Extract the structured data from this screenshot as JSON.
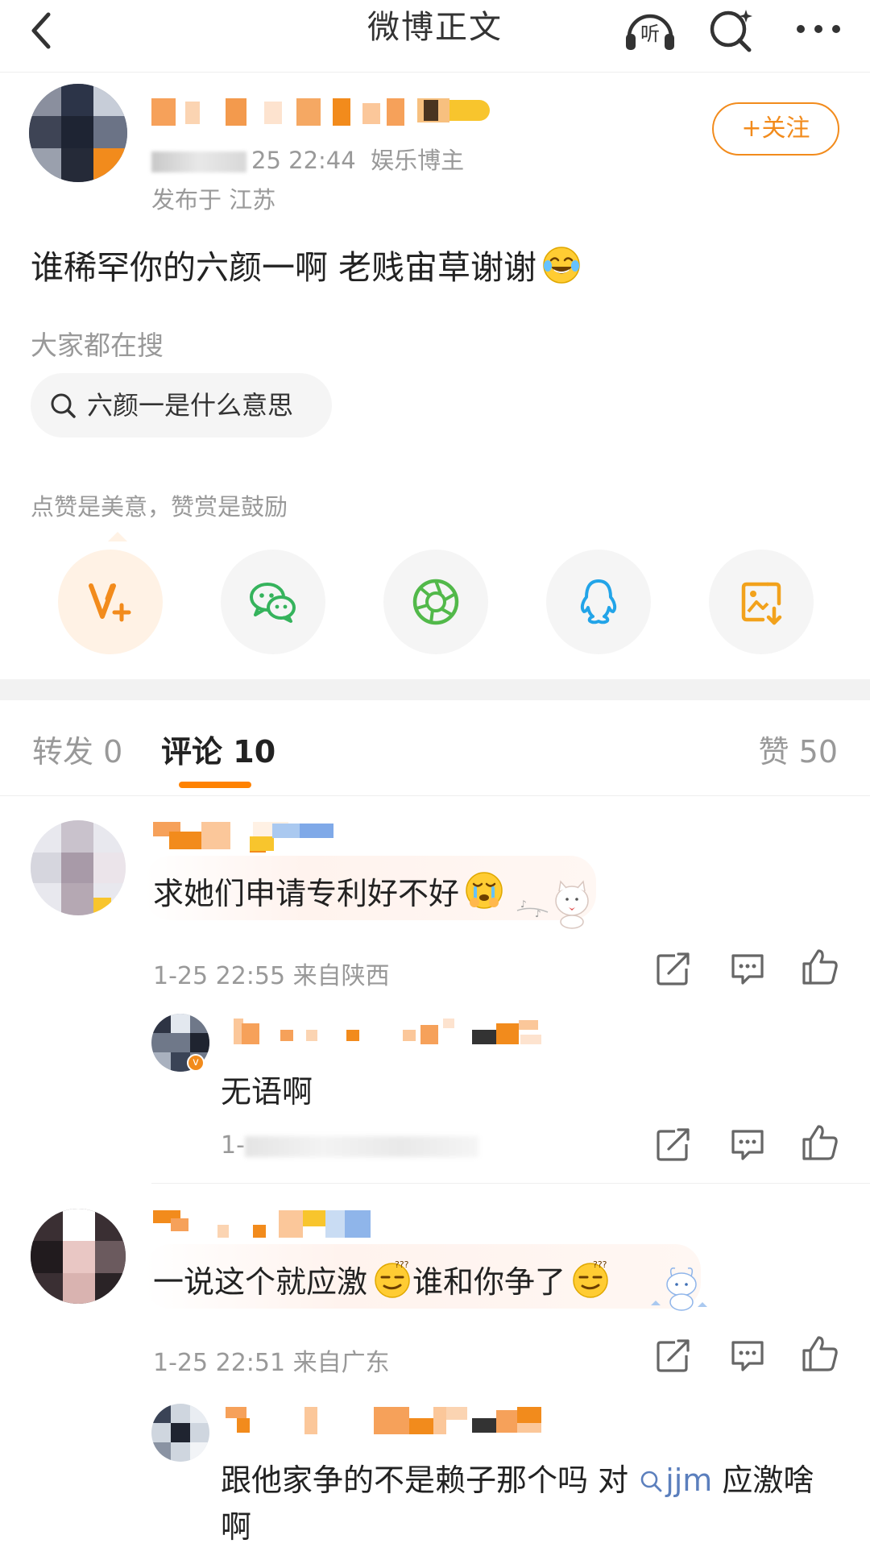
{
  "header": {
    "title": "微博正文",
    "listen_label": "听"
  },
  "post": {
    "time": "25 22:44",
    "tag": "娱乐博主",
    "location": "发布于 江苏",
    "follow_label": "+关注",
    "text": "谁稀罕你的六颜一啊 老贱宙草谢谢",
    "search_section_label": "大家都在搜",
    "search_chip": "六颜一是什么意思",
    "reward_text": "点赞是美意，赞赏是鼓励",
    "share_icons": [
      "reward-v-plus-icon",
      "wechat-icon",
      "moments-icon",
      "qq-icon",
      "save-image-icon"
    ]
  },
  "tabs": {
    "forward_label": "转发",
    "forward_count": "0",
    "comment_label": "评论",
    "comment_count": "10",
    "like_label": "赞",
    "like_count": "50",
    "accent": "#ff8200"
  },
  "comments": [
    {
      "text": "求她们申请专利好不好",
      "meta": "1-25 22:55 来自陕西",
      "reply": {
        "text": "无语啊",
        "meta": "1-"
      }
    },
    {
      "text_a": "一说这个就应激",
      "text_b": "谁和你争了",
      "meta": "1-25 22:51 来自广东",
      "reply": {
        "text_prefix": "跟他家争的不是赖子那个吗 对",
        "link_text": "jjm",
        "text_suffix": "应激啥",
        "text_line2": "啊"
      }
    }
  ],
  "colors": {
    "orange": "#f28b1c",
    "meta_gray": "#999999",
    "link_blue": "#5b7fbd"
  }
}
